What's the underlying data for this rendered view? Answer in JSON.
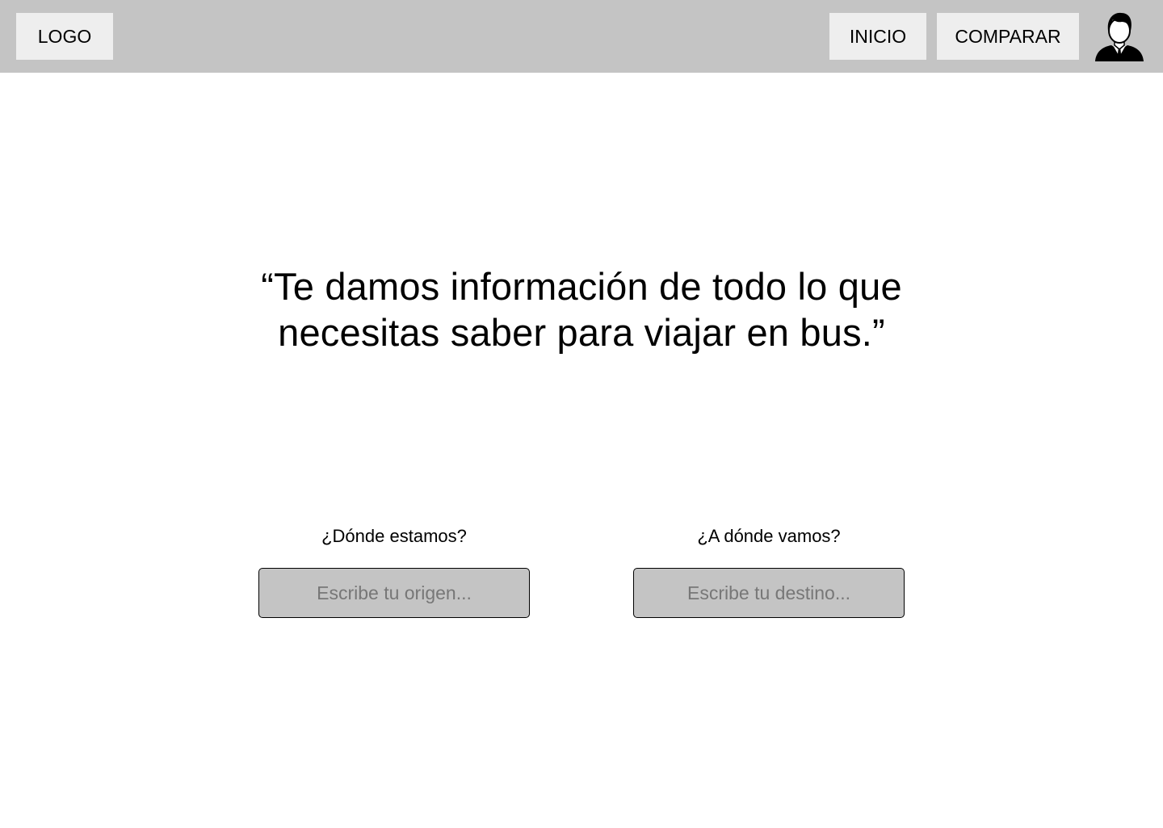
{
  "header": {
    "logo_label": "LOGO",
    "nav": {
      "inicio_label": "INICIO",
      "comparar_label": "COMPARAR"
    },
    "avatar_icon": "user-avatar-icon"
  },
  "hero": {
    "quote": "“Te damos información de todo lo que necesitas saber para viajar en bus.”"
  },
  "search": {
    "origin": {
      "label": "¿Dónde estamos?",
      "placeholder": "Escribe tu origen...",
      "value": ""
    },
    "destination": {
      "label": "¿A dónde vamos?",
      "placeholder": "Escribe tu destino...",
      "value": ""
    }
  },
  "colors": {
    "topbar_bg": "#c4c4c4",
    "button_bg": "#eeeeee",
    "input_bg": "#c4c4c4",
    "placeholder_text": "#777777"
  }
}
